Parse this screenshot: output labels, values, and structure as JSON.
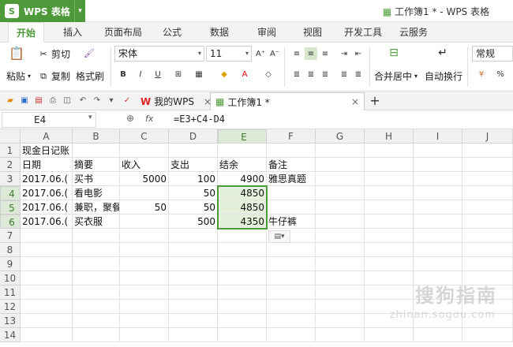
{
  "app": {
    "name": "WPS 表格",
    "logo": "S",
    "window_title": "工作簿1 * - WPS 表格"
  },
  "menu": [
    "开始",
    "插入",
    "页面布局",
    "公式",
    "数据",
    "审阅",
    "视图",
    "开发工具",
    "云服务"
  ],
  "ribbon": {
    "cut": "剪切",
    "paste": "粘贴",
    "copy": "复制",
    "format_painter": "格式刷",
    "font_name": "宋体",
    "font_size": "11",
    "merge_center": "合并居中",
    "auto_wrap": "自动换行",
    "number_format": "常规",
    "percent": "%"
  },
  "tabs": {
    "home": "我的WPS",
    "workbook": "工作簿1 *"
  },
  "formula_bar": {
    "name_box": "E4",
    "fx": "fx",
    "formula": "=E3+C4-D4"
  },
  "columns": [
    "A",
    "B",
    "C",
    "D",
    "E",
    "F",
    "G",
    "H",
    "I",
    "J"
  ],
  "rows": [
    "1",
    "2",
    "3",
    "4",
    "5",
    "6",
    "7",
    "8",
    "9",
    "10",
    "11",
    "12",
    "13",
    "14"
  ],
  "cells": {
    "r1": {
      "A": "现金日记账"
    },
    "r2": {
      "A": "日期",
      "B": "摘要",
      "C": "收入",
      "D": "支出",
      "E": "结余",
      "F": "备注"
    },
    "r3": {
      "A": "2017.06.(",
      "B": "买书",
      "C": "5000",
      "D": "100",
      "E": "4900",
      "F": "雅思真题"
    },
    "r4": {
      "A": "2017.06.(",
      "B": "看电影",
      "D": "50",
      "E": "4850"
    },
    "r5": {
      "A": "2017.06.(",
      "B": "兼职，聚餐",
      "C": "50",
      "D": "50",
      "E": "4850"
    },
    "r6": {
      "A": "2017.06.(",
      "B": "买衣服",
      "D": "500",
      "E": "4350",
      "F": "牛仔裤"
    }
  },
  "watermark": {
    "main": "搜狗指南",
    "sub": "zhinan.sogou.com"
  },
  "colors": {
    "accent": "#4e9a3b",
    "selection_fill": "#e4f0dc",
    "header_bg": "#f0f0f0"
  }
}
